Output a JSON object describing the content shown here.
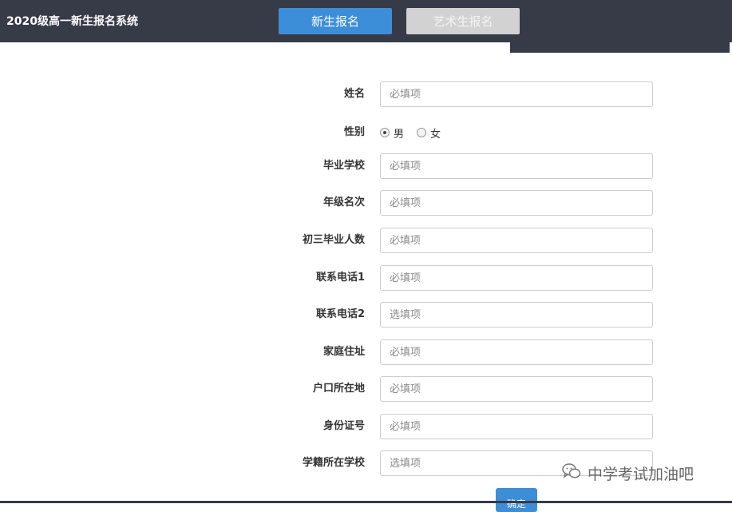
{
  "header": {
    "title": "2020级高一新生报名系统",
    "tabs": [
      {
        "label": "新生报名",
        "active": true
      },
      {
        "label": "艺术生报名",
        "active": false
      }
    ]
  },
  "form": {
    "fields": [
      {
        "label": "姓名",
        "placeholder": "必填项"
      },
      {
        "label": "毕业学校",
        "placeholder": "必填项"
      },
      {
        "label": "年级名次",
        "placeholder": "必填项"
      },
      {
        "label": "初三毕业人数",
        "placeholder": "必填项"
      },
      {
        "label": "联系电话1",
        "placeholder": "必填项"
      },
      {
        "label": "联系电话2",
        "placeholder": "选填项"
      },
      {
        "label": "家庭住址",
        "placeholder": "必填项"
      },
      {
        "label": "户口所在地",
        "placeholder": "必填项"
      },
      {
        "label": "身份证号",
        "placeholder": "必填项"
      },
      {
        "label": "学籍所在学校",
        "placeholder": "选填项"
      }
    ],
    "gender": {
      "label": "性别",
      "options": [
        {
          "label": "男",
          "checked": true
        },
        {
          "label": "女",
          "checked": false
        }
      ]
    },
    "submit_label": "确定"
  },
  "watermark": {
    "text": "中学考试加油吧",
    "icon": "wechat-icon"
  },
  "colors": {
    "header_bg": "#373a47",
    "primary": "#3c8ed8",
    "inactive_tab": "#d2d2d2"
  }
}
